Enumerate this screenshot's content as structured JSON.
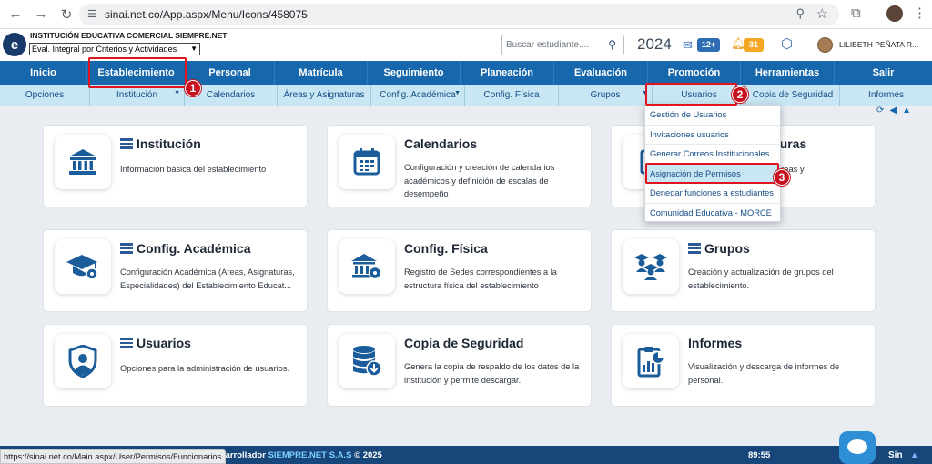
{
  "browser": {
    "url": "sinai.net.co/App.aspx/Menu/Icons/458075"
  },
  "header": {
    "institution": "INSTITUCIÓN EDUCATIVA COMERCIAL SIEMPRE.NET",
    "eval_select": "Eval. Integral por Criterios y Actividades",
    "search_placeholder": "Buscar estudiante....",
    "year": "2024",
    "mail_count": "12+",
    "notif_count": "31",
    "user_name": "LILIBETH PEÑATA R..."
  },
  "main_nav": [
    "Inicio",
    "Establecimiento",
    "Personal",
    "Matrícula",
    "Seguimiento",
    "Planeación",
    "Evaluación",
    "Promoción",
    "Herramientas",
    "Salir"
  ],
  "sub_nav": [
    "Opciones",
    "Institución",
    "Calendarios",
    "Áreas y Asignaturas",
    "Config. Académica",
    "Config. Física",
    "Grupos",
    "Usuarios",
    "Copia de Seguridad",
    "Informes"
  ],
  "dropdown": [
    "Gestión de Usuarios",
    "Invitaciones usuarios",
    "Generar Correos Institucionales",
    "Asignación de Permisos",
    "Denegar funciones a estudiantes",
    "Comunidad Educativa - MORCE"
  ],
  "cards": [
    {
      "title": "Institución",
      "desc": "Información básica del establecimiento",
      "icon": "bank-icon"
    },
    {
      "title": "Calendarios",
      "desc": "Configuración y creación de calendarios académicos y definición de escalas de desempeño",
      "icon": "calendar-icon"
    },
    {
      "title": "turas",
      "desc": "Áreas y",
      "icon": "book-icon"
    },
    {
      "title": "Config. Académica",
      "desc": "Configuración Académica (Areas, Asignaturas, Especialidades) del Establecimiento Educat...",
      "icon": "graduation-gear-icon"
    },
    {
      "title": "Config. Física",
      "desc": "Registro de Sedes correspondientes a la estructura física del establecimiento",
      "icon": "building-gear-icon"
    },
    {
      "title": "Grupos",
      "desc": "Creación y actualización de grupos del establecimiento.",
      "icon": "students-group-icon"
    },
    {
      "title": "Usuarios",
      "desc": "Opciones para la administración de usuarios.",
      "icon": "user-shield-icon"
    },
    {
      "title": "Copia de Seguridad",
      "desc": "Genera la copia de respaldo de los datos de la institución y permite descargar.",
      "icon": "database-download-icon"
    },
    {
      "title": "Informes",
      "desc": "Visualización y descarga de informes de personal.",
      "icon": "report-chart-icon"
    }
  ],
  "annotations": [
    "1",
    "2",
    "3"
  ],
  "status": {
    "link_preview": "https://sinai.net.co/Main.aspx/User/Permisos/Funcionarios",
    "dev_text": "esarrollador",
    "dev_brand": "SIEMPRE.NET S.A.S",
    "year_text": "© 2025",
    "timer": "89:55",
    "brand_short": "Sin"
  },
  "colors": {
    "nav_blue": "#1667ac",
    "sub_blue": "#c8e6f3",
    "highlight_red": "#e0141e",
    "icon_blue": "#1b5d9b"
  }
}
